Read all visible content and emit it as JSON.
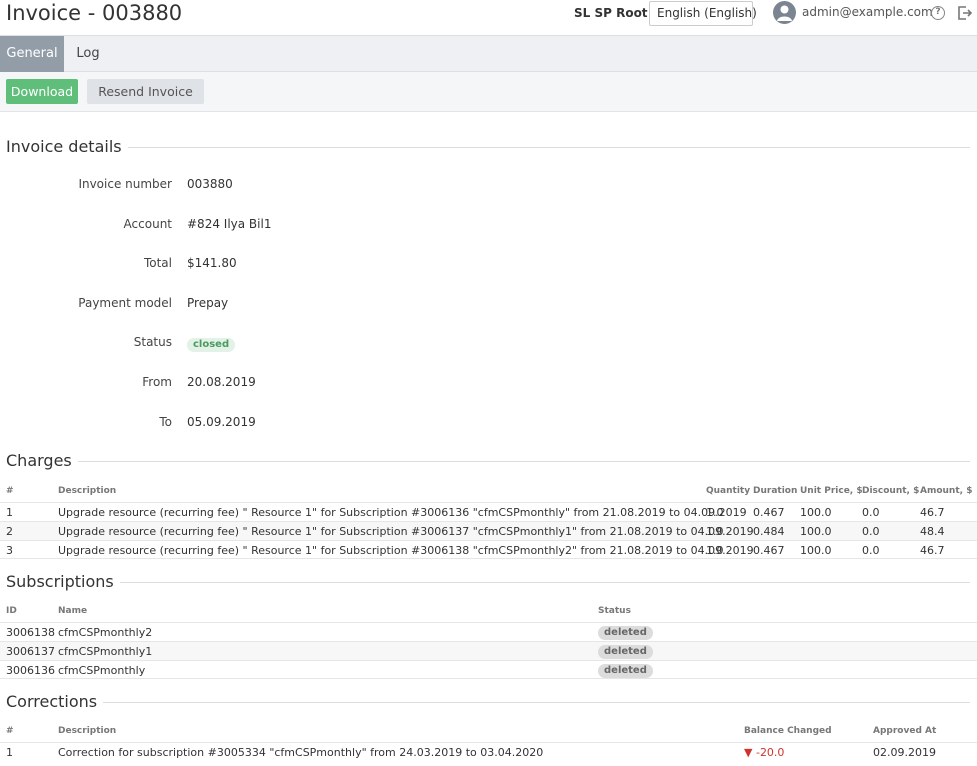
{
  "header": {
    "title": "Invoice - 003880",
    "env_name": "SL SP Root",
    "language": "English (English)",
    "user_email": "admin@example.com",
    "icons": [
      "avatar-icon",
      "help-icon",
      "logout-icon"
    ]
  },
  "tabs": [
    {
      "label": "General",
      "active": true
    },
    {
      "label": "Log",
      "active": false
    }
  ],
  "toolbar": {
    "download_label": "Download",
    "resend_label": "Resend Invoice",
    "download_color": "#5fbf7a"
  },
  "details": {
    "section_title": "Invoice details",
    "fields": [
      {
        "label": "Invoice number",
        "value": "003880"
      },
      {
        "label": "Account",
        "value": "#824 Ilya Bil1"
      },
      {
        "label": "Total",
        "value": "$141.80"
      },
      {
        "label": "Payment model",
        "value": "Prepay"
      },
      {
        "label": "Status",
        "value": "closed"
      },
      {
        "label": "From",
        "value": "20.08.2019"
      },
      {
        "label": "To",
        "value": "05.09.2019"
      }
    ]
  },
  "charges": {
    "section_title": "Charges",
    "columns": [
      "#",
      "Description",
      "Quantity",
      "Duration",
      "Unit Price, $",
      "Discount, $",
      "Amount, $"
    ],
    "rows": [
      [
        "1",
        "Upgrade resource (recurring fee) \" Resource 1\" for Subscription #3006136 \"cfmCSPmonthly\" from 21.08.2019 to 04.09.2019",
        "1.0",
        "0.467",
        "100.0",
        "0.0",
        "46.7"
      ],
      [
        "2",
        "Upgrade resource (recurring fee) \" Resource 1\" for Subscription #3006137 \"cfmCSPmonthly1\" from 21.08.2019 to 04.09.2019",
        "1.0",
        "0.484",
        "100.0",
        "0.0",
        "48.4"
      ],
      [
        "3",
        "Upgrade resource (recurring fee) \" Resource 1\" for Subscription #3006138 \"cfmCSPmonthly2\" from 21.08.2019 to 04.09.2019",
        "1.0",
        "0.467",
        "100.0",
        "0.0",
        "46.7"
      ]
    ]
  },
  "subscriptions": {
    "section_title": "Subscriptions",
    "columns": [
      "ID",
      "Name",
      "Status"
    ],
    "rows": [
      [
        "3006138",
        "cfmCSPmonthly2",
        "deleted"
      ],
      [
        "3006137",
        "cfmCSPmonthly1",
        "deleted"
      ],
      [
        "3006136",
        "cfmCSPmonthly",
        "deleted"
      ]
    ]
  },
  "corrections": {
    "section_title": "Corrections",
    "columns": [
      "#",
      "Description",
      "Balance Changed",
      "Approved At"
    ],
    "rows": [
      [
        "1",
        "Correction for subscription #3005334 \"cfmCSPmonthly\" from 24.03.2019 to 03.04.2020",
        "-20.0",
        "02.09.2019"
      ]
    ],
    "negative_color": "#d0322c"
  }
}
